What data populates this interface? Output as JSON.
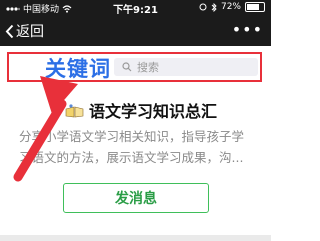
{
  "status_bar": {
    "carrier": "中国移动",
    "time": "下午9:21",
    "battery": "72%",
    "battery_level": 0.72
  },
  "nav": {
    "back_label": "返回",
    "more_label": "•••"
  },
  "search": {
    "placeholder": "搜索"
  },
  "annotation": {
    "keyword_label": "关键词",
    "highlight_color": "#e8303a"
  },
  "account": {
    "title": "语文学习知识总汇",
    "description_lines": [
      "分享小学语文学习相关知识，指导孩子学",
      "习语文的方法，展示语文学习成果，沟..."
    ]
  },
  "actions": {
    "send_label": "发消息"
  },
  "colors": {
    "accent_green": "#2a9d46",
    "keyword_blue": "#2c6fe6"
  }
}
